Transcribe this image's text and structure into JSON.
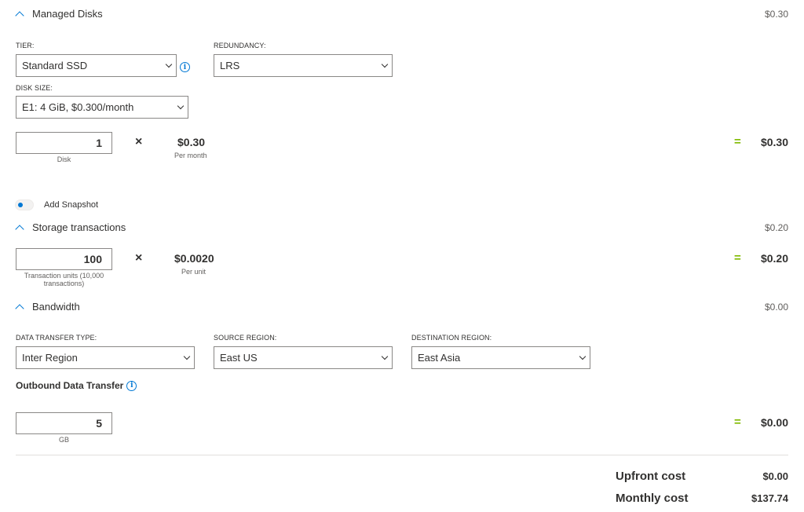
{
  "managed_disks": {
    "title": "Managed Disks",
    "price": "$0.30",
    "tier": {
      "label": "TIER:",
      "value": "Standard SSD"
    },
    "redundancy": {
      "label": "REDUNDANCY:",
      "value": "LRS"
    },
    "disk_size": {
      "label": "DISK SIZE:",
      "value": "E1: 4 GiB, $0.300/month"
    },
    "qty": {
      "value": "1",
      "unit": "Disk"
    },
    "unit_price": {
      "value": "$0.30",
      "sub": "Per month"
    },
    "total": "$0.30"
  },
  "snapshot": {
    "label": "Add Snapshot",
    "enabled": false
  },
  "storage_transactions": {
    "title": "Storage transactions",
    "price": "$0.20",
    "qty": {
      "value": "100",
      "unit": "Transaction units (10,000 transactions)"
    },
    "unit_price": {
      "value": "$0.0020",
      "sub": "Per unit"
    },
    "total": "$0.20"
  },
  "bandwidth": {
    "title": "Bandwidth",
    "price": "$0.00",
    "transfer_type": {
      "label": "DATA TRANSFER TYPE:",
      "value": "Inter Region"
    },
    "source_region": {
      "label": "SOURCE REGION:",
      "value": "East US"
    },
    "destination_region": {
      "label": "DESTINATION REGION:",
      "value": "East Asia"
    },
    "outbound_label": "Outbound Data Transfer",
    "qty": {
      "value": "5",
      "unit": "GB"
    },
    "total": "$0.00"
  },
  "symbols": {
    "times": "×",
    "equals": "=",
    "info": "i"
  },
  "summary": {
    "upfront_label": "Upfront cost",
    "upfront_value": "$0.00",
    "monthly_label": "Monthly cost",
    "monthly_value": "$137.74"
  },
  "colors": {
    "accent": "#0078d4",
    "equals": "#7fba00"
  },
  "icons": {
    "collapse": "chevron-up-icon",
    "dropdown": "chevron-down-icon",
    "info": "info-icon",
    "multiply": "multiply-icon",
    "equals": "equals-icon"
  }
}
